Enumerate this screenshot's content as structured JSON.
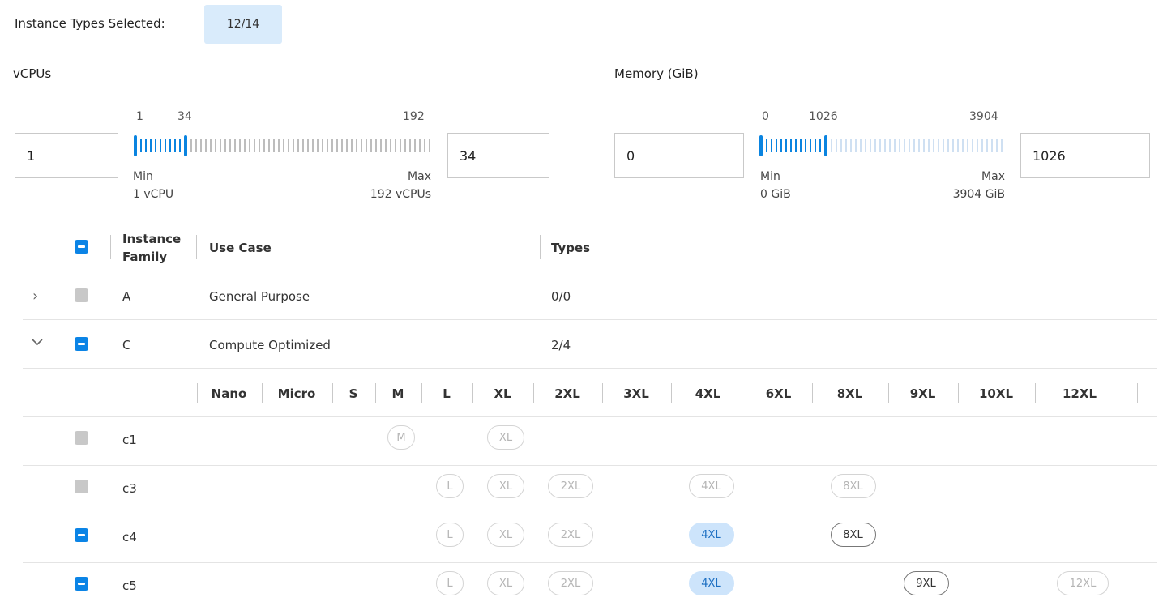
{
  "header": {
    "label": "Instance Types Selected:",
    "value": "12/14"
  },
  "vcpu": {
    "title": "vCPUs",
    "min_input": "1",
    "max_input": "34",
    "tick_low": "1",
    "tick_sel": "34",
    "tick_high": "192",
    "min_label": "Min",
    "max_label": "Max",
    "min_value": "1 vCPU",
    "max_value": "192 vCPUs",
    "range": [
      1,
      192
    ],
    "selected": [
      1,
      34
    ]
  },
  "memory": {
    "title": "Memory (GiB)",
    "min_input": "0",
    "max_input": "1026",
    "tick_low": "0",
    "tick_sel": "1026",
    "tick_high": "3904",
    "min_label": "Min",
    "max_label": "Max",
    "min_value": "0 GiB",
    "max_value": "3904 GiB",
    "range": [
      0,
      3904
    ],
    "selected": [
      0,
      1026
    ]
  },
  "table": {
    "columns": {
      "family": "Instance Family",
      "use_case": "Use Case",
      "types": "Types"
    },
    "rows": [
      {
        "family": "A",
        "use_case": "General Purpose",
        "types": "0/0"
      },
      {
        "family": "C",
        "use_case": "Compute Optimized",
        "types": "2/4"
      }
    ]
  },
  "sizes": [
    "Nano",
    "Micro",
    "S",
    "M",
    "L",
    "XL",
    "2XL",
    "3XL",
    "4XL",
    "6XL",
    "8XL",
    "9XL",
    "10XL",
    "12XL"
  ],
  "instances": [
    {
      "name": "c1",
      "pills": [
        {
          "label": "M",
          "state": "disabled"
        },
        {
          "label": "XL",
          "state": "disabled"
        }
      ]
    },
    {
      "name": "c3",
      "pills": [
        {
          "label": "L",
          "state": "disabled"
        },
        {
          "label": "XL",
          "state": "disabled"
        },
        {
          "label": "2XL",
          "state": "disabled"
        },
        {
          "label": "4XL",
          "state": "disabled"
        },
        {
          "label": "8XL",
          "state": "disabled"
        }
      ]
    },
    {
      "name": "c4",
      "pills": [
        {
          "label": "L",
          "state": "disabled"
        },
        {
          "label": "XL",
          "state": "disabled"
        },
        {
          "label": "2XL",
          "state": "disabled"
        },
        {
          "label": "4XL",
          "state": "selected"
        },
        {
          "label": "8XL",
          "state": "available"
        }
      ]
    },
    {
      "name": "c5",
      "pills": [
        {
          "label": "L",
          "state": "disabled"
        },
        {
          "label": "XL",
          "state": "disabled"
        },
        {
          "label": "2XL",
          "state": "disabled"
        },
        {
          "label": "4XL",
          "state": "selected"
        },
        {
          "label": "9XL",
          "state": "available"
        },
        {
          "label": "12XL",
          "state": "disabled"
        }
      ]
    }
  ],
  "colors": {
    "accent": "#0b84e6",
    "badge_bg": "#d9ebfb",
    "pill_selected_bg": "#cde4fb"
  }
}
